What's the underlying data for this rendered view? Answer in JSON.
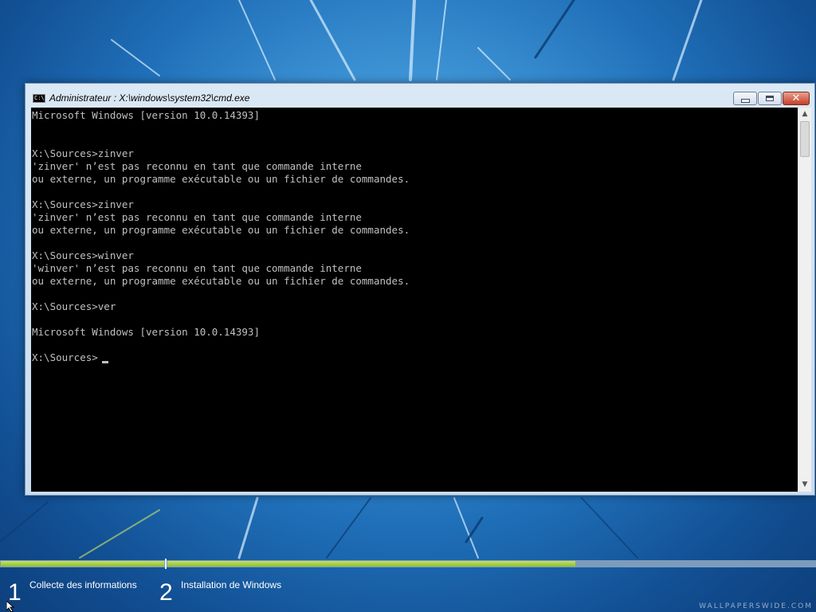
{
  "window": {
    "title": "Administrateur : X:\\windows\\system32\\cmd.exe",
    "icon_label": "C:\\"
  },
  "console": {
    "lines": [
      "Microsoft Windows [version 10.0.14393]",
      "",
      "",
      "X:\\Sources>zinver",
      "'zinver' n’est pas reconnu en tant que commande interne",
      "ou externe, un programme exécutable ou un fichier de commandes.",
      "",
      "X:\\Sources>zinver",
      "'zinver' n’est pas reconnu en tant que commande interne",
      "ou externe, un programme exécutable ou un fichier de commandes.",
      "",
      "X:\\Sources>winver",
      "'winver' n’est pas reconnu en tant que commande interne",
      "ou externe, un programme exécutable ou un fichier de commandes.",
      "",
      "X:\\Sources>ver",
      "",
      "Microsoft Windows [version 10.0.14393]",
      "",
      "X:\\Sources>"
    ]
  },
  "setup_steps": [
    {
      "number": "1",
      "label": "Collecte des informations"
    },
    {
      "number": "2",
      "label": "Installation de Windows"
    }
  ],
  "progress": {
    "step1_fraction": 1.0,
    "step2_fraction": 0.63,
    "fill_color": "#9cc83a"
  },
  "watermark": "WALLPAPERSWIDE.COM",
  "icons": [
    "cmd-icon",
    "minimize-icon",
    "maximize-icon",
    "close-icon",
    "scroll-up-icon",
    "scroll-down-icon",
    "mouse-pointer-icon"
  ]
}
